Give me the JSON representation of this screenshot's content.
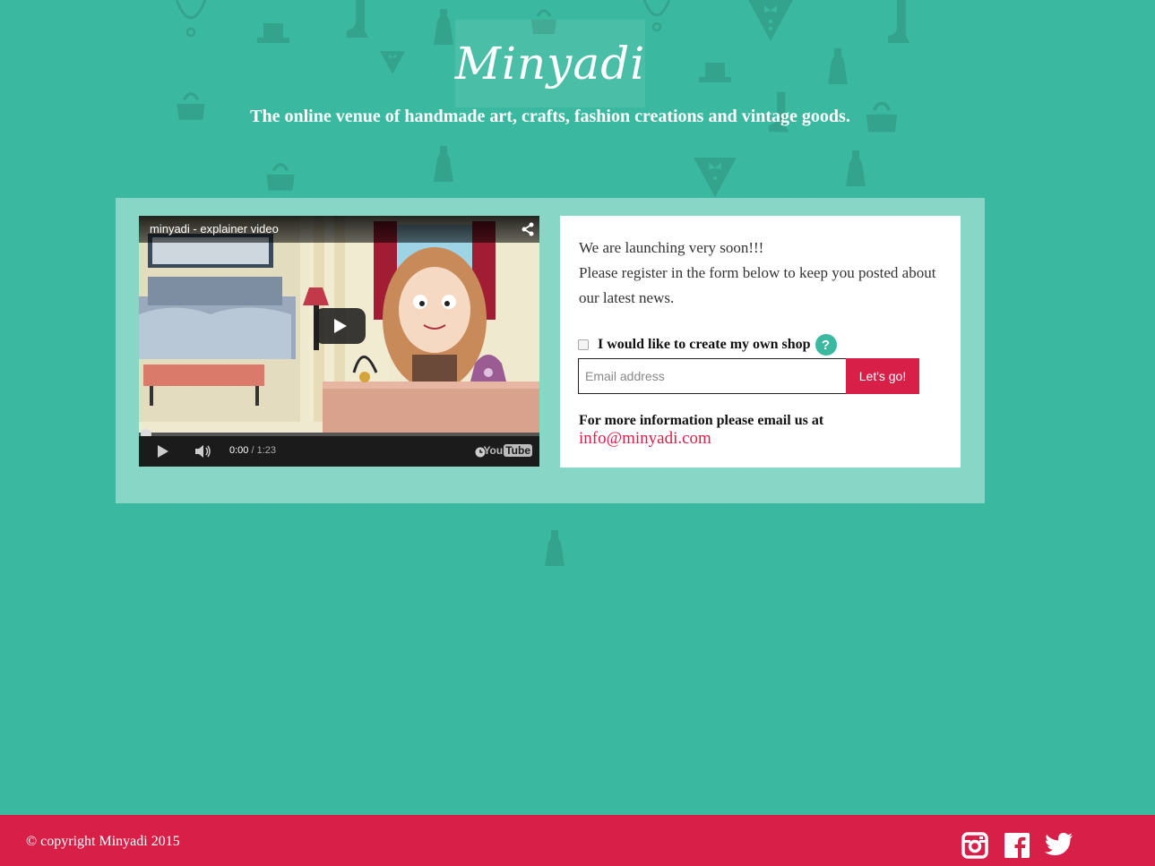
{
  "header": {
    "logo_text": "Minyadi",
    "tagline": "The online venue of handmade art, crafts, fashion creations and vintage goods."
  },
  "video": {
    "title": "minyadi - explainer video",
    "time_current": "0:00",
    "time_separator": " / ",
    "time_total": "1:23",
    "youtube_you": "You",
    "youtube_tube": "Tube"
  },
  "form": {
    "intro_line1": "We are launching very soon!!!",
    "intro_line2": "Please register in the form below to keep you posted about our latest news.",
    "shop_checkbox_label": "I would like to create my own shop",
    "help_label": "?",
    "email_placeholder": "Email address",
    "submit_label": "Let's go!",
    "more_info_label": "For more information please email us at",
    "contact_email": "info@minyadi.com"
  },
  "footer": {
    "copyright": "© copyright Minyadi 2015",
    "social_icons": [
      "instagram-icon",
      "facebook-icon",
      "twitter-icon"
    ]
  },
  "colors": {
    "background": "#3bb9a0",
    "panel": "#87d6c6",
    "accent": "#d71f48",
    "decoration": "#1f6e5f"
  }
}
